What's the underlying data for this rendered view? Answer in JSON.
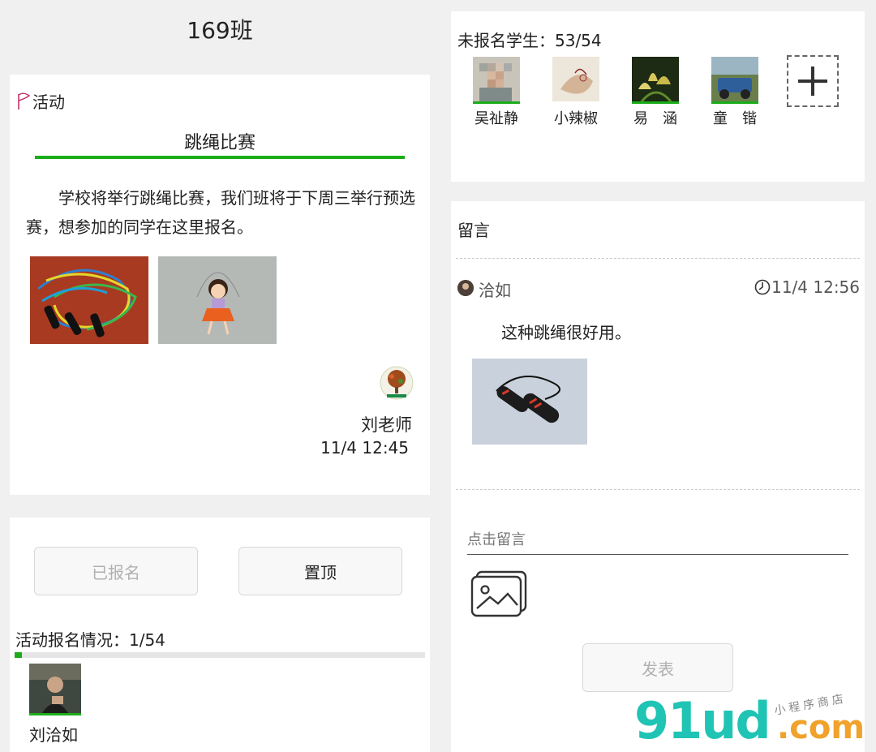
{
  "class_name": "169班",
  "activity": {
    "tag": "活动",
    "title": "跳绳比赛",
    "description": "学校将举行跳绳比赛，我们班将于下周三举行预选赛，想参加的同学在这里报名。",
    "teacher": "刘老师",
    "time": "11/4 12:45"
  },
  "actions": {
    "signed_label": "已报名",
    "pin_label": "置顶"
  },
  "signup": {
    "status_label": "活动报名情况：1/54",
    "progress": 0.0185,
    "students": [
      {
        "name": "刘洽如"
      }
    ]
  },
  "unsigned": {
    "title": "未报名学生：53/54",
    "students": [
      {
        "name": "吴祉静"
      },
      {
        "name": "小辣椒"
      },
      {
        "name": "易　涵"
      },
      {
        "name": "童　锴"
      }
    ]
  },
  "messages": {
    "title": "留言",
    "comments": [
      {
        "author": "洽如",
        "time": "11/4 12:56",
        "text": "这种跳绳很好用。"
      }
    ],
    "input_placeholder": "点击留言",
    "publish_label": "发表"
  },
  "watermark": {
    "main": "91ud",
    "domain": ".com",
    "sub": "小程序商店"
  },
  "colors": {
    "accent_green": "#1aad19",
    "watermark_teal": "#20c4b4",
    "watermark_orange": "#f0a22a"
  }
}
